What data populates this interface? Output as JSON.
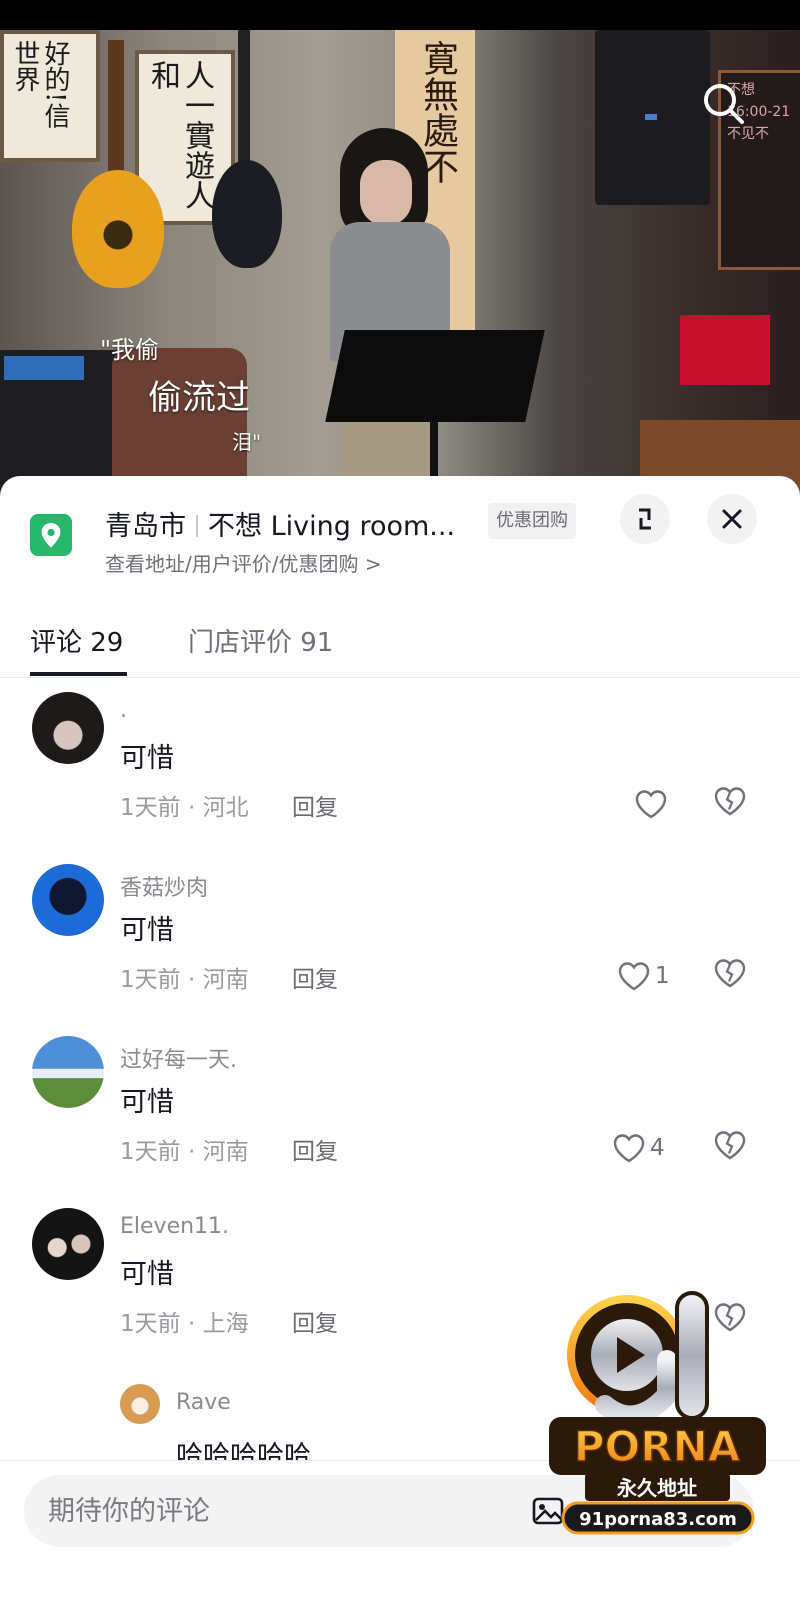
{
  "video": {
    "lyrics": [
      "\"我偷",
      "偷流过",
      "泪\""
    ],
    "poster_left_text": "好的!信世界",
    "poster_mid_text": "人一實遊人和",
    "scroll_text": "寛無處不",
    "board_text": "不想 16:00-21 不见不"
  },
  "location": {
    "city": "青岛市",
    "place": "不想 Living room...",
    "deal_badge": "优惠团购",
    "subtitle": "查看地址/用户评价/优惠团购 >"
  },
  "tabs": [
    {
      "label": "评论 29"
    },
    {
      "label": "门店评价 91"
    }
  ],
  "comments": [
    {
      "name": ".",
      "text": "可惜",
      "meta": "1天前 · 河北",
      "reply": "回复",
      "likes": ""
    },
    {
      "name": "香菇炒肉",
      "text": "可惜",
      "meta": "1天前 · 河南",
      "reply": "回复",
      "likes": "1"
    },
    {
      "name": "过好每一天.",
      "text": "可惜",
      "meta": "1天前 · 河南",
      "reply": "回复",
      "likes": "4"
    },
    {
      "name": "Eleven11.",
      "text": "可惜",
      "meta": "1天前 · 上海",
      "reply": "回复",
      "likes": ""
    }
  ],
  "sub_reply": {
    "name": "Rave",
    "text": "哈哈哈哈哈"
  },
  "input": {
    "placeholder": "期待你的评论"
  },
  "watermark": {
    "brand_number": "91",
    "brand_word": "PORNA",
    "tagline": "永久地址",
    "url": "91porna83.com"
  },
  "colors": {
    "location_green": "#25b86a",
    "text_primary": "#161823",
    "text_secondary": "#8a8b91",
    "watermark_orange": "#f29b1d"
  }
}
